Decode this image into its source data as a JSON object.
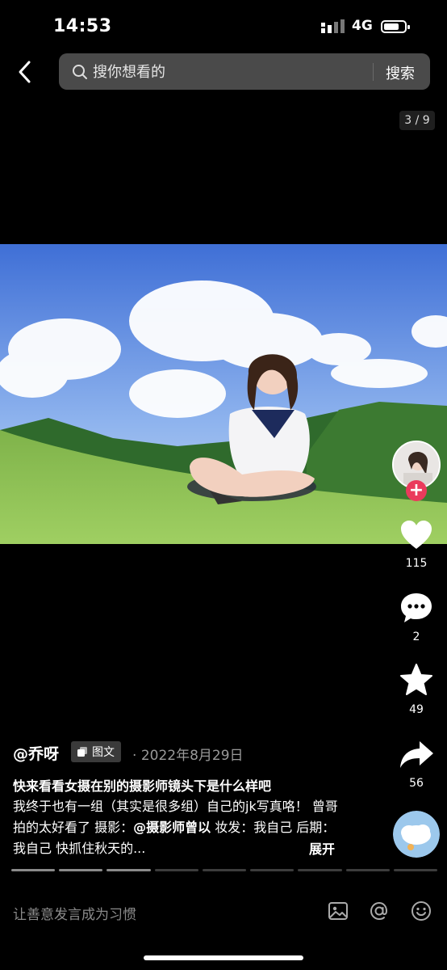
{
  "status_bar": {
    "time": "14:53",
    "network": "4G"
  },
  "top_nav": {
    "search_placeholder": "搜你想看的",
    "search_button": "搜索",
    "image_counter": "3 / 9"
  },
  "right_rail": {
    "like_count": "115",
    "comment_count": "2",
    "favorite_count": "49",
    "share_count": "56",
    "follow_symbol": "+"
  },
  "post": {
    "author": "@乔呀",
    "type_tag": "图文",
    "date_sep": "·",
    "date": "2022年8月29日",
    "title": "快来看看女摄在别的摄影师镜头下是什么样吧",
    "desc_part1": "我终于也有一组（其实是很多组）自己的jk写真咯！ 曾哥拍的太好看了 摄影：",
    "desc_mention": "@摄影师曾以",
    "desc_part2": " 妆发：我自己 后期：我自己 快抓住秋天的...",
    "expand": "展开",
    "image_total": 9,
    "image_current": 3
  },
  "bottom_bar": {
    "comment_placeholder": "让善意发言成为习惯"
  },
  "icons": [
    "back-icon",
    "search-icon",
    "heart-icon",
    "comment-icon",
    "star-icon",
    "share-icon",
    "image-icon",
    "at-icon",
    "emoji-icon"
  ],
  "colors": {
    "background": "#000000",
    "follow_badge": "#ea3a5c",
    "search_bg": "#4a4a4a"
  }
}
